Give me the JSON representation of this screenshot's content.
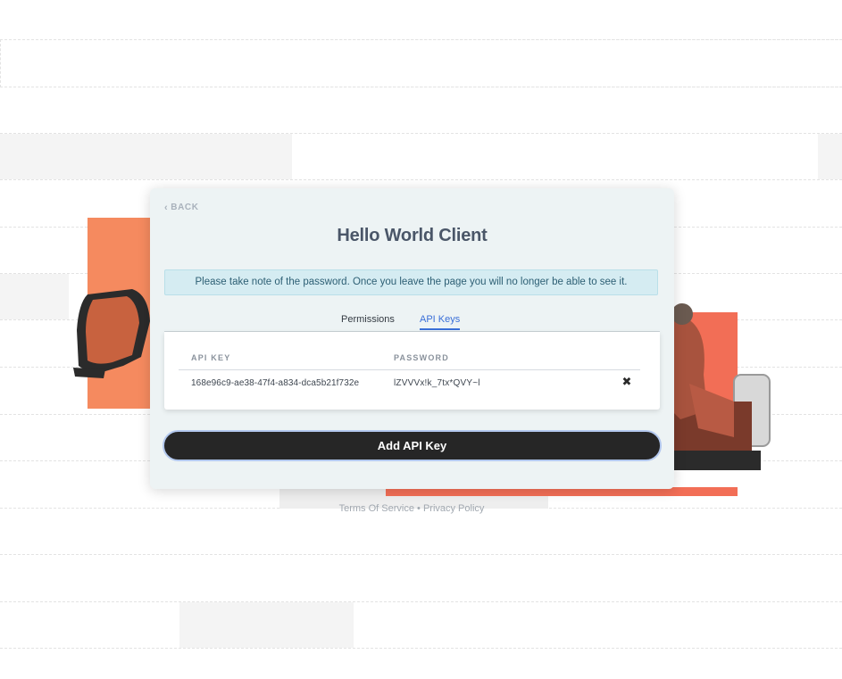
{
  "card": {
    "back_label": "BACK",
    "title": "Hello World Client",
    "notice": "Please take note of the password. Once you leave the page you will no longer be able to see it."
  },
  "tabs": [
    {
      "label": "Permissions",
      "active": false
    },
    {
      "label": "API Keys",
      "active": true
    }
  ],
  "table": {
    "headers": {
      "key": "API KEY",
      "password": "PASSWORD"
    },
    "rows": [
      {
        "key": "168e96c9-ae38-47f4-a834-dca5b21f732e",
        "password": "lZVVVx!k_7tx*QVY~l"
      }
    ]
  },
  "actions": {
    "add_label": "Add API Key"
  },
  "footer": {
    "terms": "Terms Of Service",
    "separator": "•",
    "privacy": "Privacy Policy"
  },
  "colors": {
    "accent": "#3a6fd8",
    "button_bg": "#262626",
    "notice_bg": "#d5ecf2",
    "illustration_orange": "#f58a5f",
    "illustration_red": "#f26e56"
  },
  "icons": {
    "back": "chevron-left-icon",
    "delete": "close-icon"
  }
}
